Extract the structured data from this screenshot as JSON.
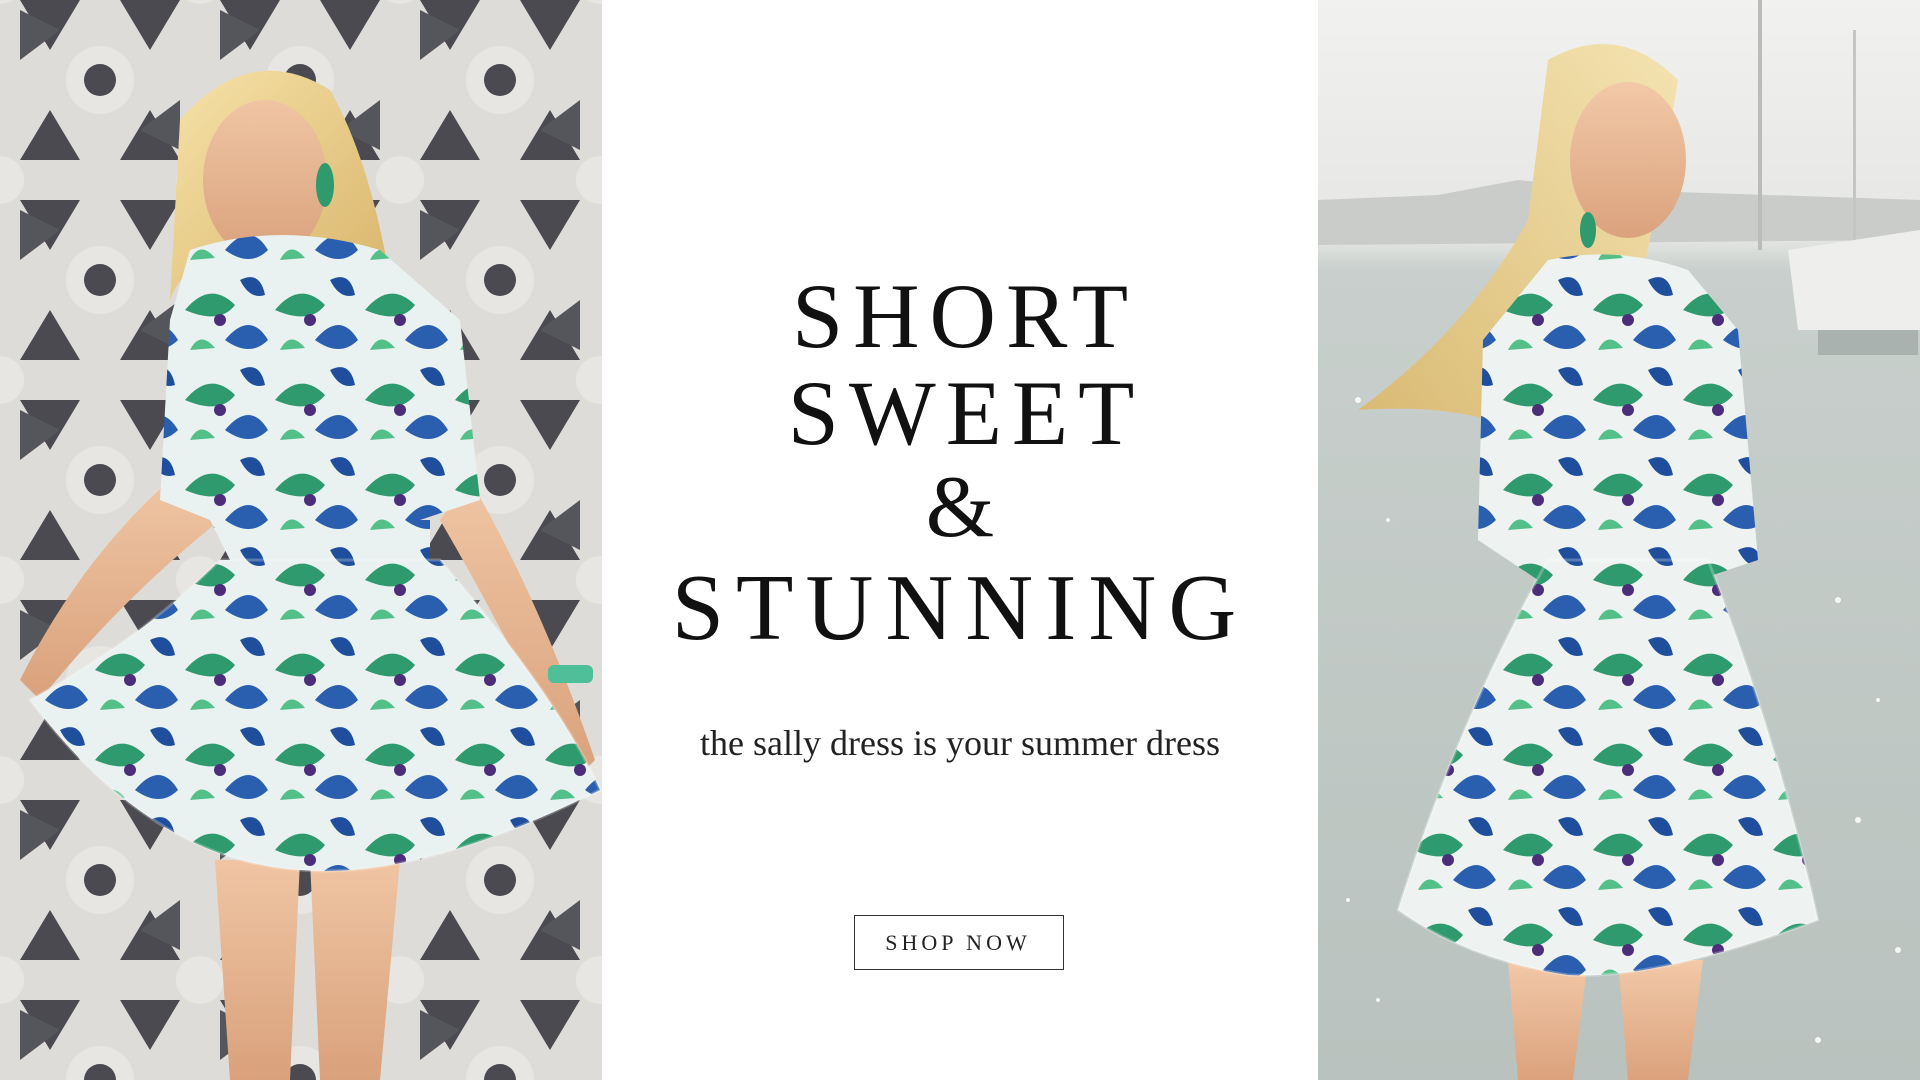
{
  "banner": {
    "headline": {
      "line1": "SHORT",
      "line2": "SWEET",
      "line3": "&",
      "line4": "STUNNING"
    },
    "tagline": "the sally dress is your summer dress",
    "cta_label": "SHOP NOW"
  },
  "images": {
    "left": "model in tropical print dress against breeze-block wall",
    "right": "model in tropical print dress at harbor"
  },
  "colors": {
    "text": "#111111",
    "background": "#ffffff",
    "print_green": "#2e9a6e",
    "print_blue": "#2a5fb0"
  }
}
